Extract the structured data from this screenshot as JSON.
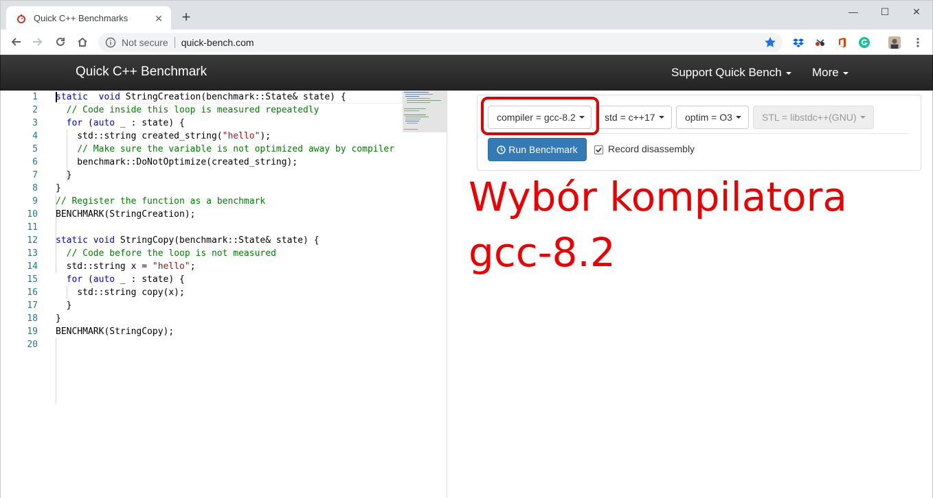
{
  "browser": {
    "tab_title": "Quick C++ Benchmarks",
    "tab_close": "✕",
    "new_tab": "+",
    "window_controls": {
      "minimize": "—",
      "maximize": "☐",
      "close": "✕"
    },
    "omnibox": {
      "security_label": "Not secure",
      "url": "quick-bench.com"
    },
    "extensions": [
      "dropbox-icon",
      "extension-icon",
      "office-icon",
      "grammarly-icon",
      "profile-avatar",
      "menu-icon"
    ]
  },
  "navbar": {
    "brand": "Quick C++ Benchmark",
    "links": [
      {
        "label": "Support Quick Bench"
      },
      {
        "label": "More"
      }
    ]
  },
  "editor": {
    "line_numbers": [
      "1",
      "2",
      "3",
      "4",
      "5",
      "6",
      "7",
      "8",
      "9",
      "10",
      "11",
      "12",
      "13",
      "14",
      "15",
      "16",
      "17",
      "18",
      "19",
      "20"
    ],
    "lines": [
      [
        [
          "kw",
          "static"
        ],
        [
          "",
          "  "
        ],
        [
          "kw",
          "void"
        ],
        [
          "",
          " StringCreation(benchmark::State& state) {"
        ]
      ],
      [
        [
          "",
          "  "
        ],
        [
          "cm",
          "// Code inside this loop is measured repeatedly"
        ]
      ],
      [
        [
          "",
          "  "
        ],
        [
          "kw",
          "for"
        ],
        [
          "",
          " ("
        ],
        [
          "kw",
          "auto"
        ],
        [
          "",
          " _ : state) {"
        ]
      ],
      [
        [
          "",
          "    std::string created_string("
        ],
        [
          "st",
          "\"hello\""
        ],
        [
          "",
          ");"
        ]
      ],
      [
        [
          "",
          "    "
        ],
        [
          "cm",
          "// Make sure the variable is not optimized away by compiler"
        ]
      ],
      [
        [
          "",
          "    benchmark::DoNotOptimize(created_string);"
        ]
      ],
      [
        [
          "",
          "  }"
        ]
      ],
      [
        [
          "",
          "}"
        ]
      ],
      [
        [
          "cm",
          "// Register the function as a benchmark"
        ]
      ],
      [
        [
          "",
          "BENCHMARK(StringCreation);"
        ]
      ],
      [
        [
          "",
          ""
        ]
      ],
      [
        [
          "kw",
          "static"
        ],
        [
          "",
          " "
        ],
        [
          "kw",
          "void"
        ],
        [
          "",
          " StringCopy(benchmark::State& state) {"
        ]
      ],
      [
        [
          "",
          "  "
        ],
        [
          "cm",
          "// Code before the loop is not measured"
        ]
      ],
      [
        [
          "",
          "  std::string x = "
        ],
        [
          "st",
          "\"hello\""
        ],
        [
          "",
          ";"
        ]
      ],
      [
        [
          "",
          "  "
        ],
        [
          "kw",
          "for"
        ],
        [
          "",
          " ("
        ],
        [
          "kw",
          "auto"
        ],
        [
          "",
          " _ : state) {"
        ]
      ],
      [
        [
          "",
          "    std::string copy(x);"
        ]
      ],
      [
        [
          "",
          "  }"
        ]
      ],
      [
        [
          "",
          "}"
        ]
      ],
      [
        [
          "",
          "BENCHMARK(StringCopy);"
        ]
      ],
      [
        [
          "",
          ""
        ]
      ]
    ]
  },
  "options": {
    "compiler": "compiler = gcc-8.2",
    "std": "std = c++17",
    "optim": "optim = O3",
    "stl": "STL = libstdc++(GNU)",
    "run_label": "Run Benchmark",
    "record_label": "Record disassembly",
    "record_checked": true
  },
  "annotation": {
    "line1": "Wybór kompilatora",
    "line2": "gcc-8.2"
  },
  "colors": {
    "annotation": "#ee0000",
    "run_button": "#337ab7",
    "navbar": "#222222",
    "keyword": "#0000ff",
    "comment": "#008000",
    "string": "#a31515"
  }
}
